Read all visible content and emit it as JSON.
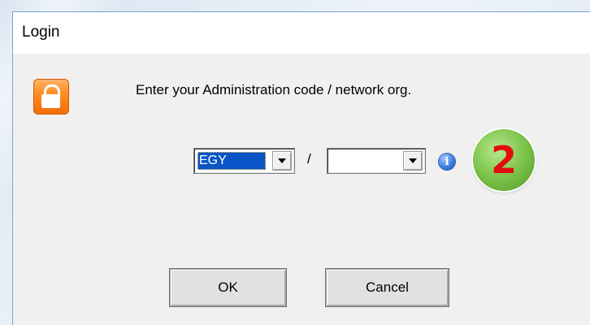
{
  "window": {
    "title": "Login"
  },
  "dialog": {
    "prompt": "Enter your Administration code / network org.",
    "admin_code": {
      "selected": "EGY"
    },
    "separator": "/",
    "network_org": {
      "selected": ""
    },
    "info_icon_glyph": "i",
    "step_badge": "2",
    "buttons": {
      "ok_label": "OK",
      "cancel_label": "Cancel"
    }
  },
  "icons": {
    "lock": "lock-icon",
    "info": "info-icon",
    "dropdown": "chevron-down-icon"
  },
  "colors": {
    "selection": "#0a54c8",
    "lock_orange": "#ff8a1e",
    "badge_green": "#7cc34a",
    "badge_text": "#e30d0d"
  }
}
